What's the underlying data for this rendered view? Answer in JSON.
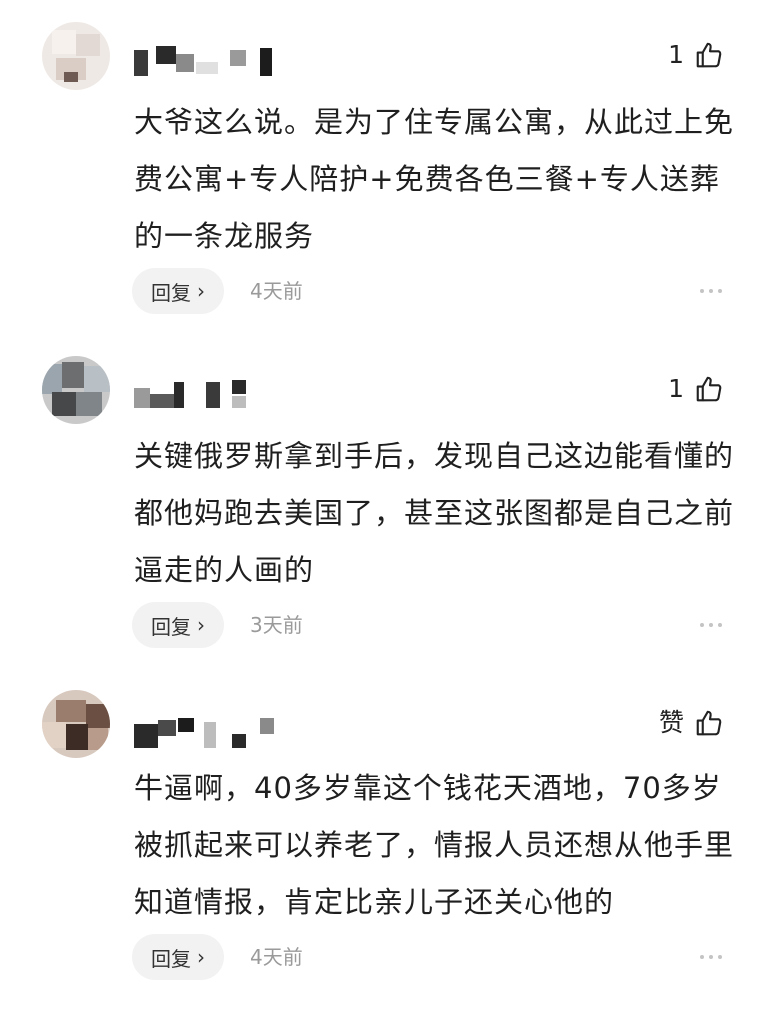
{
  "comments": [
    {
      "likes": "1",
      "text": "大爷这么说。是为了住专属公寓，从此过上免费公寓+专人陪护+免费各色三餐+专人送葬的一条龙服务",
      "reply_label": "回复",
      "time": "4天前"
    },
    {
      "likes": "1",
      "text": "关键俄罗斯拿到手后，发现自己这边能看懂的都他妈跑去美国了，甚至这张图都是自己之前逼走的人画的",
      "reply_label": "回复",
      "time": "3天前"
    },
    {
      "likes": "赞",
      "text": "牛逼啊，40多岁靠这个钱花天酒地，70多岁被抓起来可以养老了，情报人员还想从他手里知道情报，肯定比亲儿子还关心他的",
      "reply_label": "回复",
      "time": "4天前"
    }
  ],
  "icons": {
    "like": "thumbs-up-icon",
    "reply_arrow": "chevron-right-icon",
    "more": "more-dots-icon"
  },
  "colors": {
    "text": "#1f1f1f",
    "meta": "#9a9a9a",
    "reply_bg": "#f2f2f2"
  }
}
